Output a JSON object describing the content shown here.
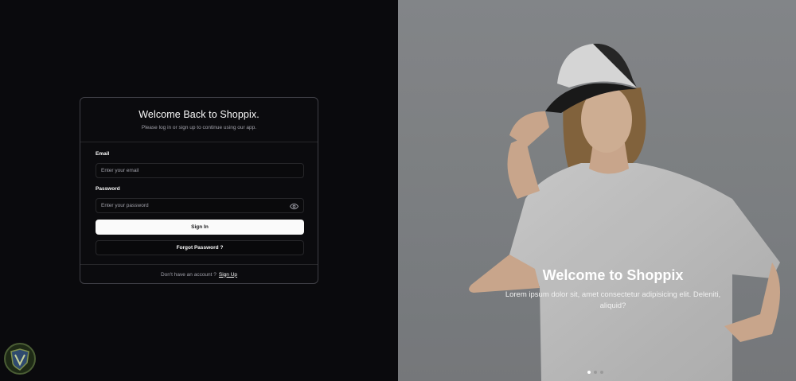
{
  "login": {
    "title": "Welcome Back to Shoppix.",
    "subtitle": "Please log in or sign up to continue using our app.",
    "email_label": "Email",
    "email_placeholder": "Enter your email",
    "password_label": "Password",
    "password_placeholder": "Enter your password",
    "sign_in_label": "Sign In",
    "forgot_label": "Forgot Password ?",
    "footer_text": "Don't have an account ?",
    "sign_up_label": "Sign Up"
  },
  "hero": {
    "title": "Welcome to Shoppix",
    "description": "Lorem ipsum dolor sit, amet consectetur adipisicing elit. Deleniti, aliquid?",
    "slides_total": 3,
    "active_slide": 1
  },
  "colors": {
    "background": "#09090b",
    "card_border": "#3f3f46",
    "primary_button": "#fafafa",
    "hero_background": "#8c8f92"
  }
}
